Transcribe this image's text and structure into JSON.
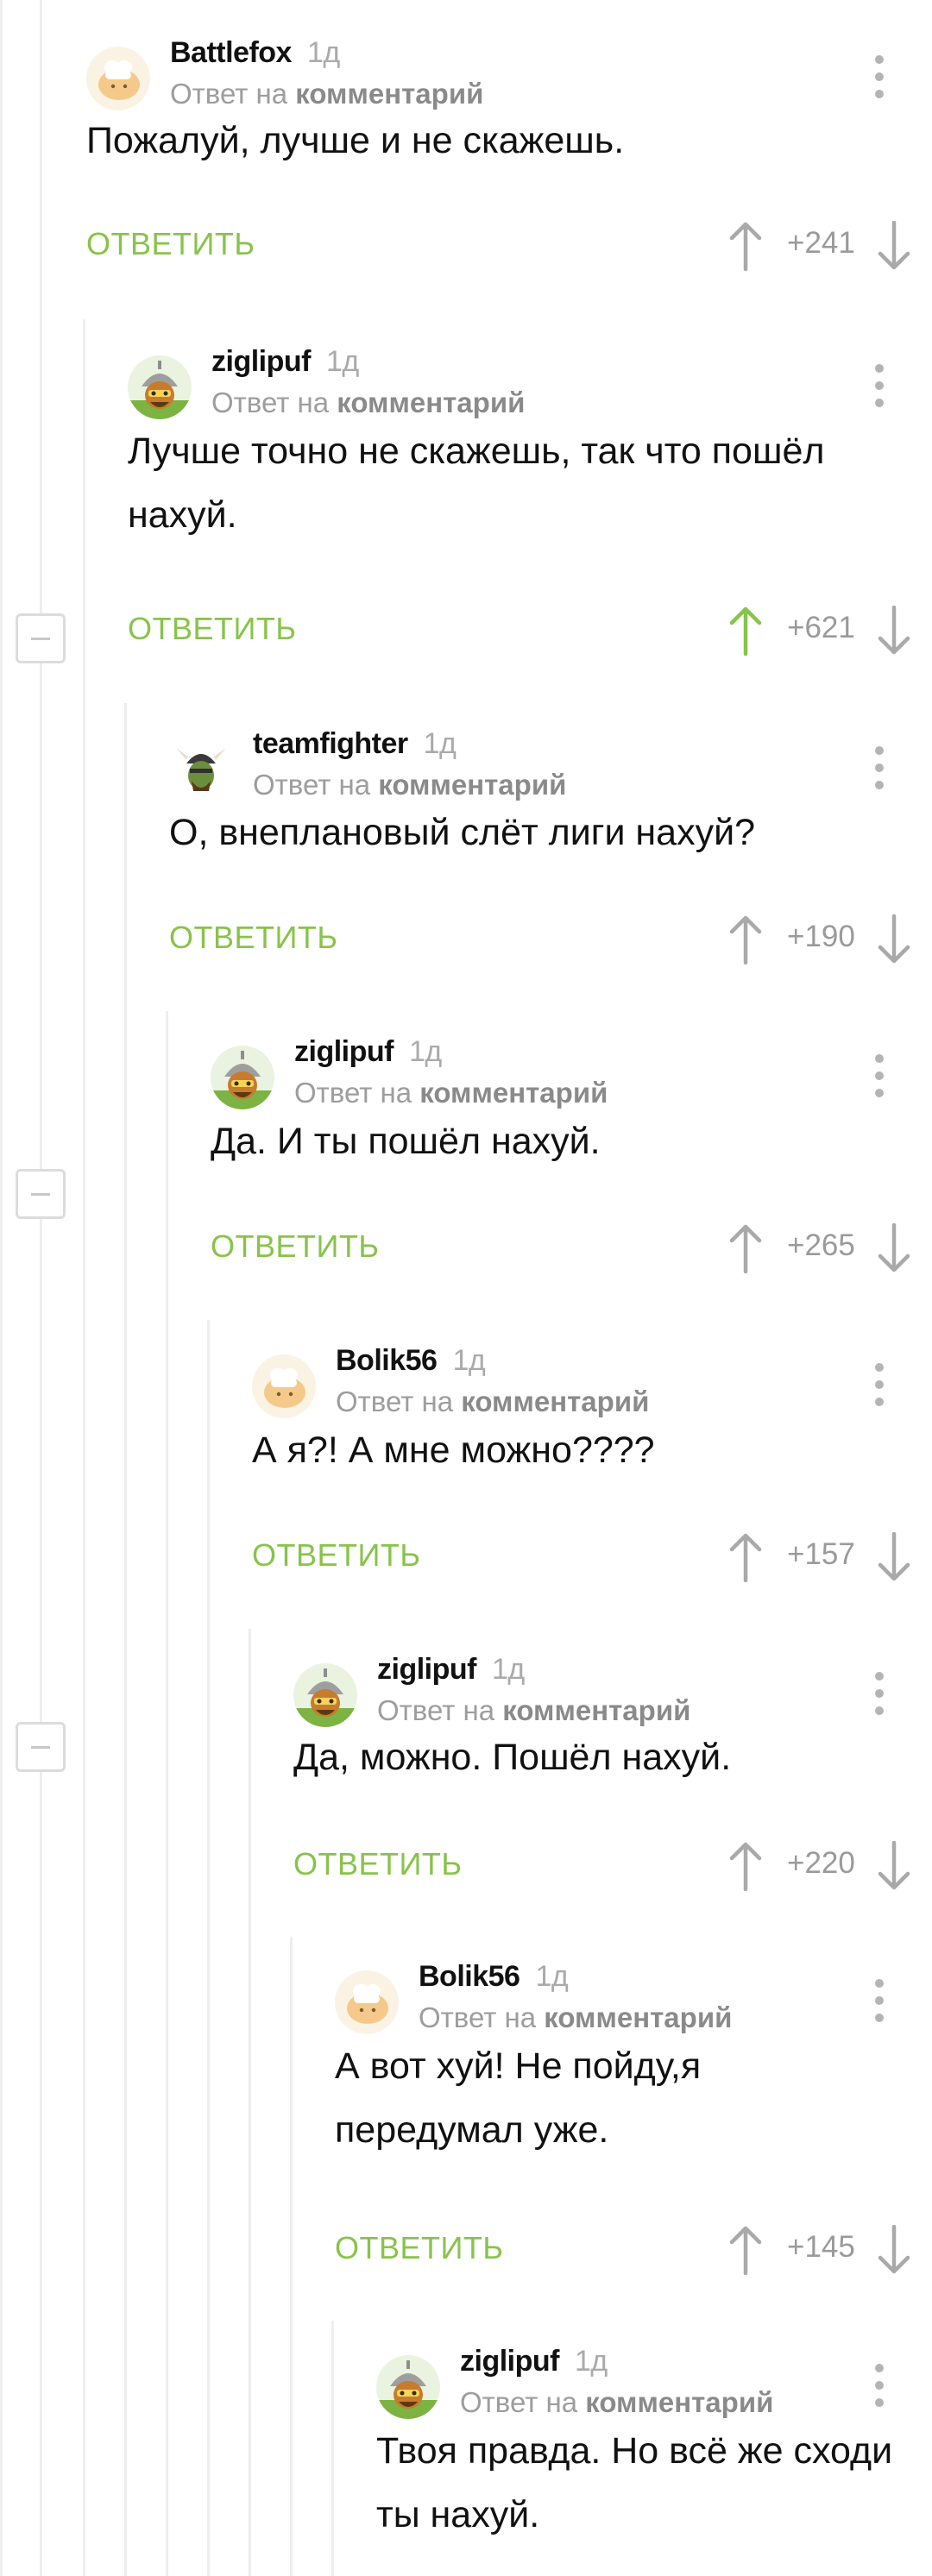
{
  "reply_label": "ОТВЕТИТЬ",
  "reply_to_prefix": "Ответ на",
  "reply_to_link": "комментарий",
  "colors": {
    "accent_green": "#88c34a",
    "meta_gray": "#9d9d9d",
    "thread_line": "#eeeeee"
  },
  "comments": [
    {
      "user": "Battlefox",
      "time": "1д",
      "text": "Пожалуй, лучше и не скажешь.",
      "score": "+241",
      "upvoted": false,
      "avatar": "chef-avatar-icon"
    },
    {
      "user": "ziglipuf",
      "time": "1д",
      "text": "Лучше точно не скажешь, так что пошёл нахуй.",
      "score": "+621",
      "upvoted": true,
      "avatar": "warrior-avatar-icon"
    },
    {
      "user": "teamfighter",
      "time": "1д",
      "text": "О, внеплановый слёт лиги нахуй?",
      "score": "+190",
      "upvoted": false,
      "avatar": "viking-avatar-icon"
    },
    {
      "user": "ziglipuf",
      "time": "1д",
      "text": "Да. И ты пошёл нахуй.",
      "score": "+265",
      "upvoted": false,
      "avatar": "warrior-avatar-icon"
    },
    {
      "user": "Bolik56",
      "time": "1д",
      "text": "А я?! А мне можно????",
      "score": "+157",
      "upvoted": false,
      "avatar": "chef-avatar-icon"
    },
    {
      "user": "ziglipuf",
      "time": "1д",
      "text": "Да, можно. Пошёл нахуй.",
      "score": "+220",
      "upvoted": false,
      "avatar": "warrior-avatar-icon"
    },
    {
      "user": "Bolik56",
      "time": "1д",
      "text": "А вот хуй! Не пойду,я передумал уже.",
      "score": "+145",
      "upvoted": false,
      "avatar": "chef-avatar-icon"
    },
    {
      "user": "ziglipuf",
      "time": "1д",
      "text": "Твоя правда. Но всё же сходи ты нахуй.",
      "score": "",
      "upvoted": false,
      "avatar": "warrior-avatar-icon"
    }
  ]
}
